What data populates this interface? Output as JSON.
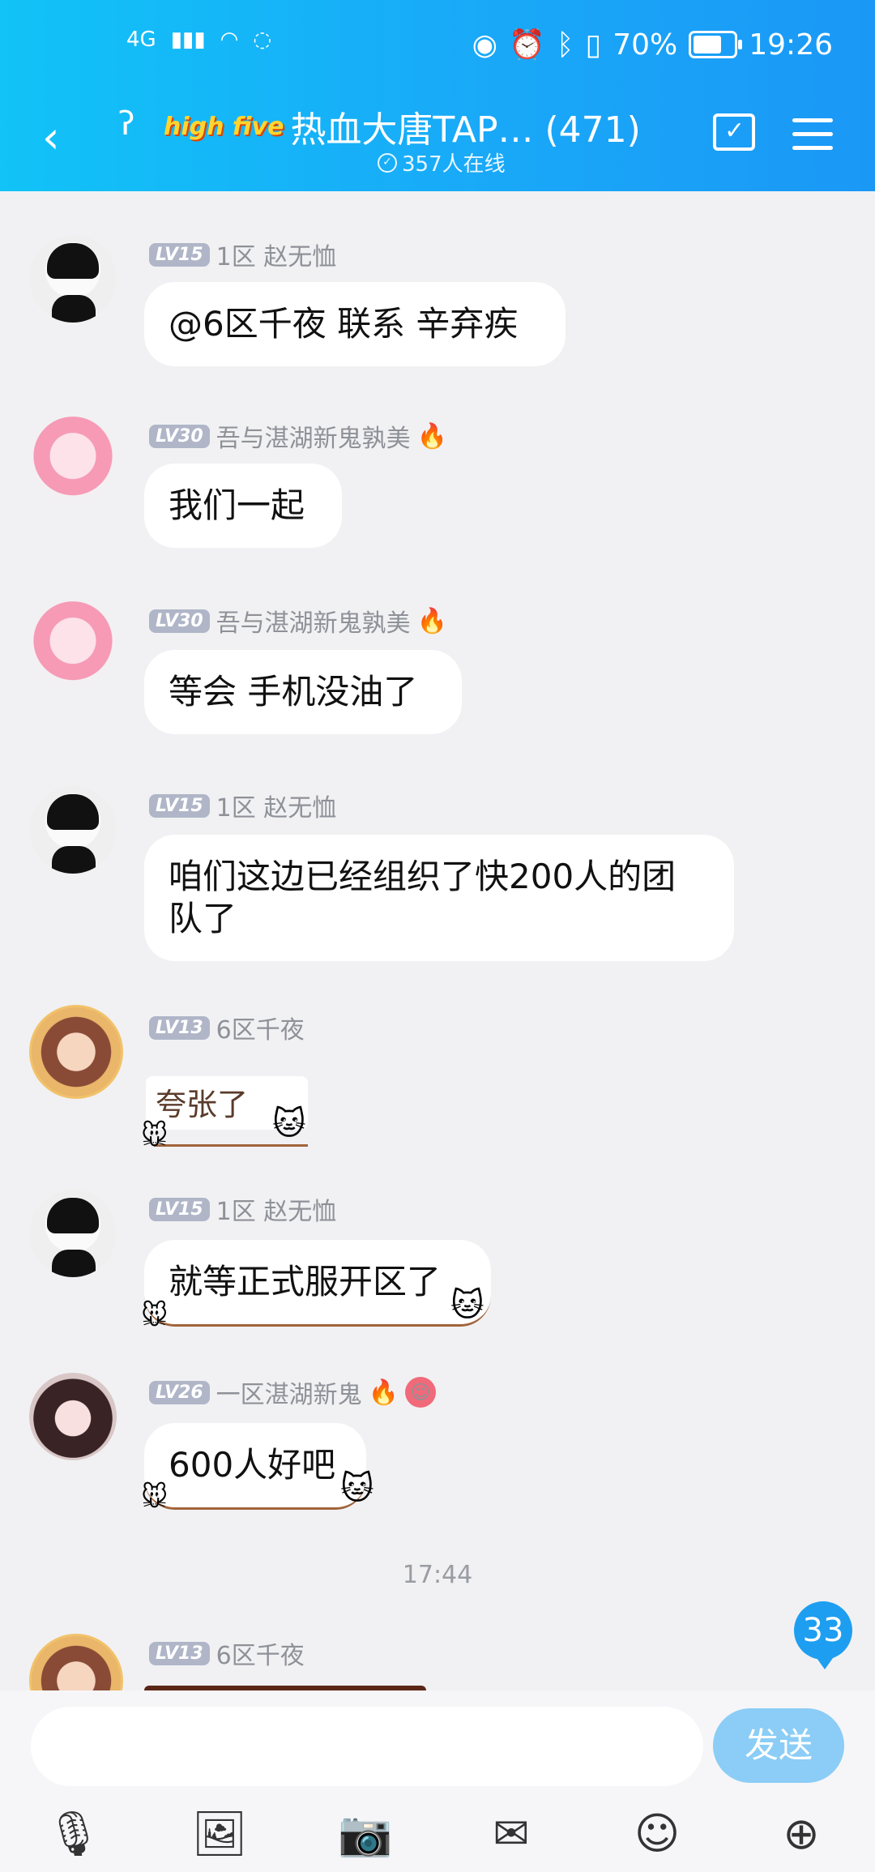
{
  "status_bar": {
    "network": "4G",
    "battery_percent": "70%",
    "battery_level": 0.7,
    "time": "19:26"
  },
  "header": {
    "logo_text": "high five",
    "title": "热血大唐TAP…  (471)",
    "online": "357人在线"
  },
  "messages": [
    {
      "level": "LV15",
      "name": "1区 赵无恤",
      "text": "@6区千夜 联系 辛弃疾"
    },
    {
      "level": "LV30",
      "name": "吾与湛湖新鬼孰美",
      "text": "我们一起"
    },
    {
      "level": "LV30",
      "name": "吾与湛湖新鬼孰美",
      "text": "等会 手机没油了"
    },
    {
      "level": "LV15",
      "name": "1区 赵无恤",
      "text": "咱们这边已经组织了快200人的团队了"
    },
    {
      "level": "LV13",
      "name": "6区千夜",
      "sticker": "夸张了"
    },
    {
      "level": "LV15",
      "name": "1区 赵无恤",
      "text": "就等正式服开区了"
    },
    {
      "level": "LV26",
      "name": "一区湛湖新鬼",
      "text": "600人好吧"
    },
    {
      "level": "LV13",
      "name": "6区千夜"
    }
  ],
  "time_separator": "17:44",
  "unread_count": "33",
  "input": {
    "placeholder": "",
    "send_label": "发送"
  },
  "toolbar": [
    "mic-icon",
    "image-icon",
    "camera-icon",
    "red-packet-icon",
    "emoji-icon",
    "plus-icon"
  ]
}
